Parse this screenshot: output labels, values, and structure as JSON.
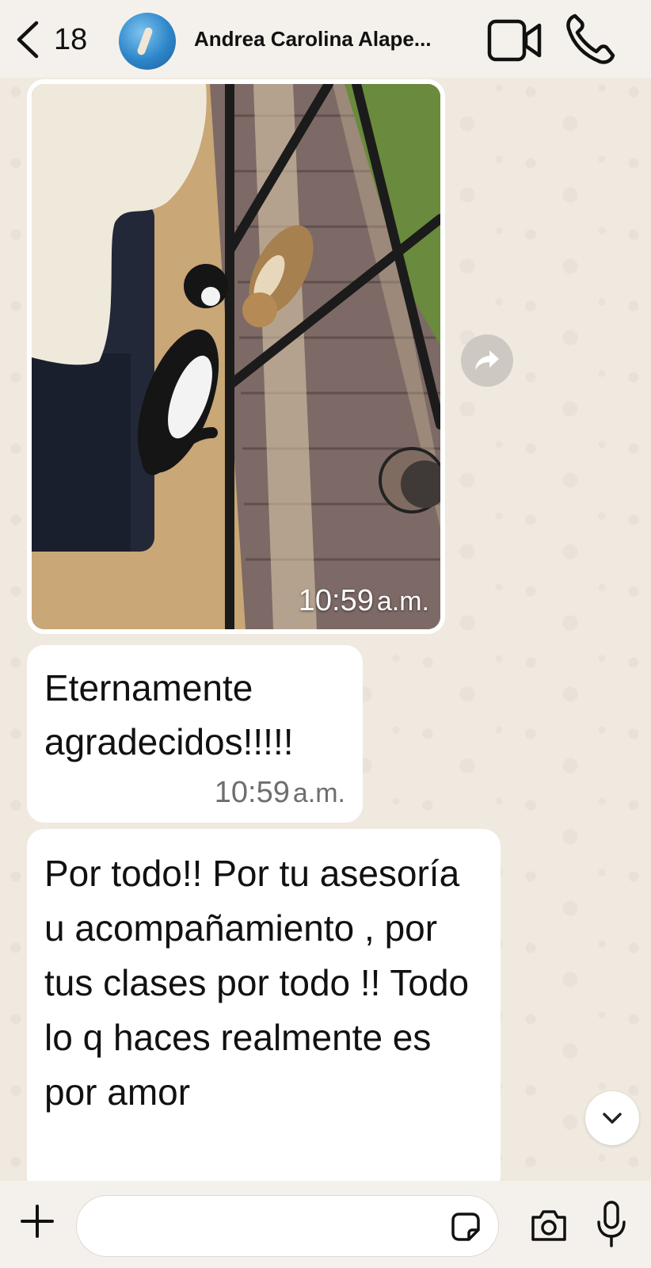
{
  "header": {
    "back_count": "18",
    "contact_name": "Andrea Carolina Alape...",
    "icons": [
      "back-chevron-icon",
      "video-call-icon",
      "phone-call-icon"
    ]
  },
  "messages": [
    {
      "type": "image",
      "time": "10:59",
      "ampm": "a.m."
    },
    {
      "type": "text",
      "text": "Eternamente agradecidos!!!!!",
      "time": "10:59",
      "ampm": "a.m."
    },
    {
      "type": "text",
      "text": "Por todo!! Por tu asesoría u acompañamiento , por tus clases por todo !! Todo lo q haces realmente es por amor"
    }
  ],
  "composer": {
    "placeholder": "",
    "icons": [
      "plus-icon",
      "sticker-icon",
      "camera-icon",
      "microphone-icon"
    ]
  },
  "colors": {
    "bar": "#f4f1ec",
    "wallpaper": "#efe9df",
    "bubble": "#ffffff",
    "meta_text": "#6e6e6e"
  }
}
